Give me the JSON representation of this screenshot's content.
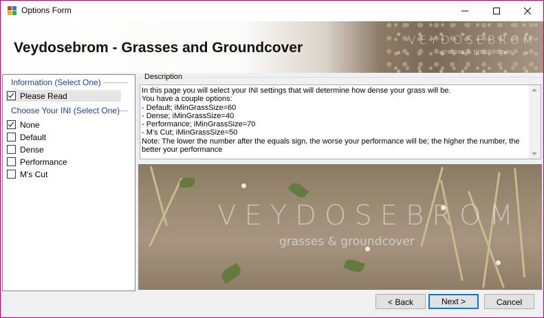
{
  "window": {
    "title": "Options Form"
  },
  "header": {
    "title": "Veydosebrom - Grasses and Groundcover",
    "watermark": "VEYDOSEBROM",
    "watermark_sub": "grasses & groundcover"
  },
  "left_panel": {
    "info_section": "Information (Select One)",
    "info_items": [
      {
        "label": "Please Read",
        "checked": true,
        "selected": true
      }
    ],
    "ini_section": "Choose Your INI (Select One)",
    "ini_items": [
      {
        "label": "None",
        "checked": true
      },
      {
        "label": "Default",
        "checked": false
      },
      {
        "label": "Dense",
        "checked": false
      },
      {
        "label": "Performance",
        "checked": false
      },
      {
        "label": "M's Cut",
        "checked": false
      }
    ]
  },
  "description": {
    "legend": "Description",
    "lines": [
      "In this page you will select your INI settings that will determine how dense your grass will be.",
      "You have a couple options:",
      "- Default; iMinGrassSize=60",
      "- Dense; iMinGrassSize=40",
      "- Performance; iMinGrassSize=70",
      "- M's Cut; iMinGrassSize=50",
      "Note: The lower the number after the equals sign, the worse your performance will be; the higher the number, the better your performance"
    ]
  },
  "banner": {
    "watermark": "VEYDOSEBROM",
    "watermark_sub": "grasses & groundcover"
  },
  "buttons": {
    "back": "< Back",
    "next": "Next >",
    "cancel": "Cancel"
  },
  "colors": {
    "accent": "#0078d7",
    "section": "#1e3f8c",
    "window_border": "#b4006e"
  }
}
